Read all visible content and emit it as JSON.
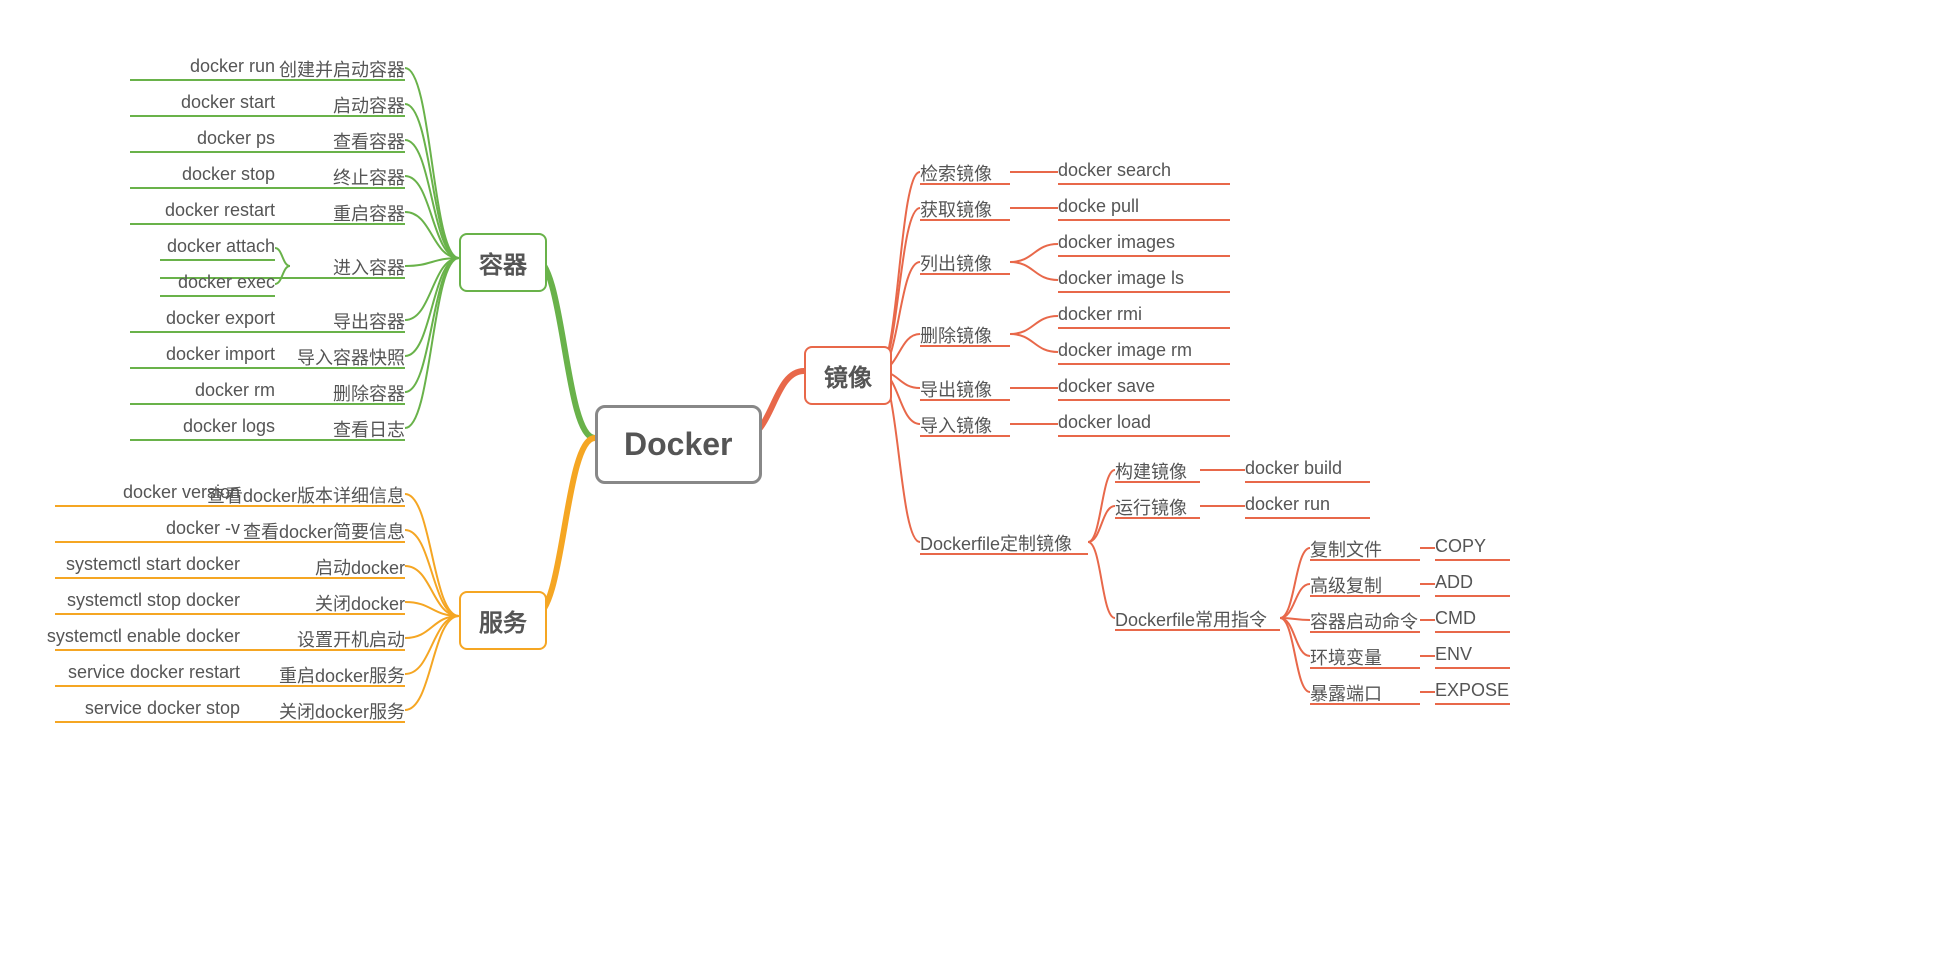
{
  "root": "Docker",
  "branches": {
    "container": "容器",
    "service": "服务",
    "image": "镜像"
  },
  "container_nodes": [
    {
      "cmd": "docker run",
      "desc": "创建并启动容器"
    },
    {
      "cmd": "docker start",
      "desc": "启动容器"
    },
    {
      "cmd": "docker ps",
      "desc": "查看容器"
    },
    {
      "cmd": "docker stop",
      "desc": "终止容器"
    },
    {
      "cmd": "docker restart",
      "desc": "重启容器"
    },
    {
      "cmd": [
        "docker attach",
        "docker exec"
      ],
      "desc": "进入容器"
    },
    {
      "cmd": "docker export",
      "desc": "导出容器"
    },
    {
      "cmd": "docker import",
      "desc": "导入容器快照"
    },
    {
      "cmd": "docker rm",
      "desc": "删除容器"
    },
    {
      "cmd": "docker logs",
      "desc": "查看日志"
    }
  ],
  "service_nodes": [
    {
      "cmd": "docker version",
      "desc": "查看docker版本详细信息"
    },
    {
      "cmd": "docker -v",
      "desc": "查看docker简要信息"
    },
    {
      "cmd": "systemctl start docker",
      "desc": "启动docker"
    },
    {
      "cmd": "systemctl stop docker",
      "desc": "关闭docker"
    },
    {
      "cmd": "systemctl enable docker",
      "desc": "设置开机启动"
    },
    {
      "cmd": "service docker restart",
      "desc": "重启docker服务"
    },
    {
      "cmd": "service docker stop",
      "desc": "关闭docker服务"
    }
  ],
  "image_nodes": [
    {
      "desc": "检索镜像",
      "cmd": "docker search"
    },
    {
      "desc": "获取镜像",
      "cmd": "docke pull"
    },
    {
      "desc": "列出镜像",
      "cmd": [
        "docker images",
        "docker image ls"
      ]
    },
    {
      "desc": "删除镜像",
      "cmd": [
        "docker rmi",
        "docker image rm"
      ]
    },
    {
      "desc": "导出镜像",
      "cmd": "docker save"
    },
    {
      "desc": "导入镜像",
      "cmd": "docker load"
    }
  ],
  "dockerfile_branch": "Dockerfile定制镜像",
  "dockerfile_nodes": [
    {
      "desc": "构建镜像",
      "cmd": "docker build"
    },
    {
      "desc": "运行镜像",
      "cmd": "docker run"
    }
  ],
  "instruction_branch": "Dockerfile常用指令",
  "instruction_nodes": [
    {
      "desc": "复制文件",
      "cmd": "COPY"
    },
    {
      "desc": "高级复制",
      "cmd": "ADD"
    },
    {
      "desc": "容器启动命令",
      "cmd": "CMD"
    },
    {
      "desc": "环境变量",
      "cmd": "ENV"
    },
    {
      "desc": "暴露端口",
      "cmd": "EXPOSE"
    }
  ],
  "colors": {
    "green": "#69b24a",
    "orange": "#f5a623",
    "red": "#e8684a"
  }
}
